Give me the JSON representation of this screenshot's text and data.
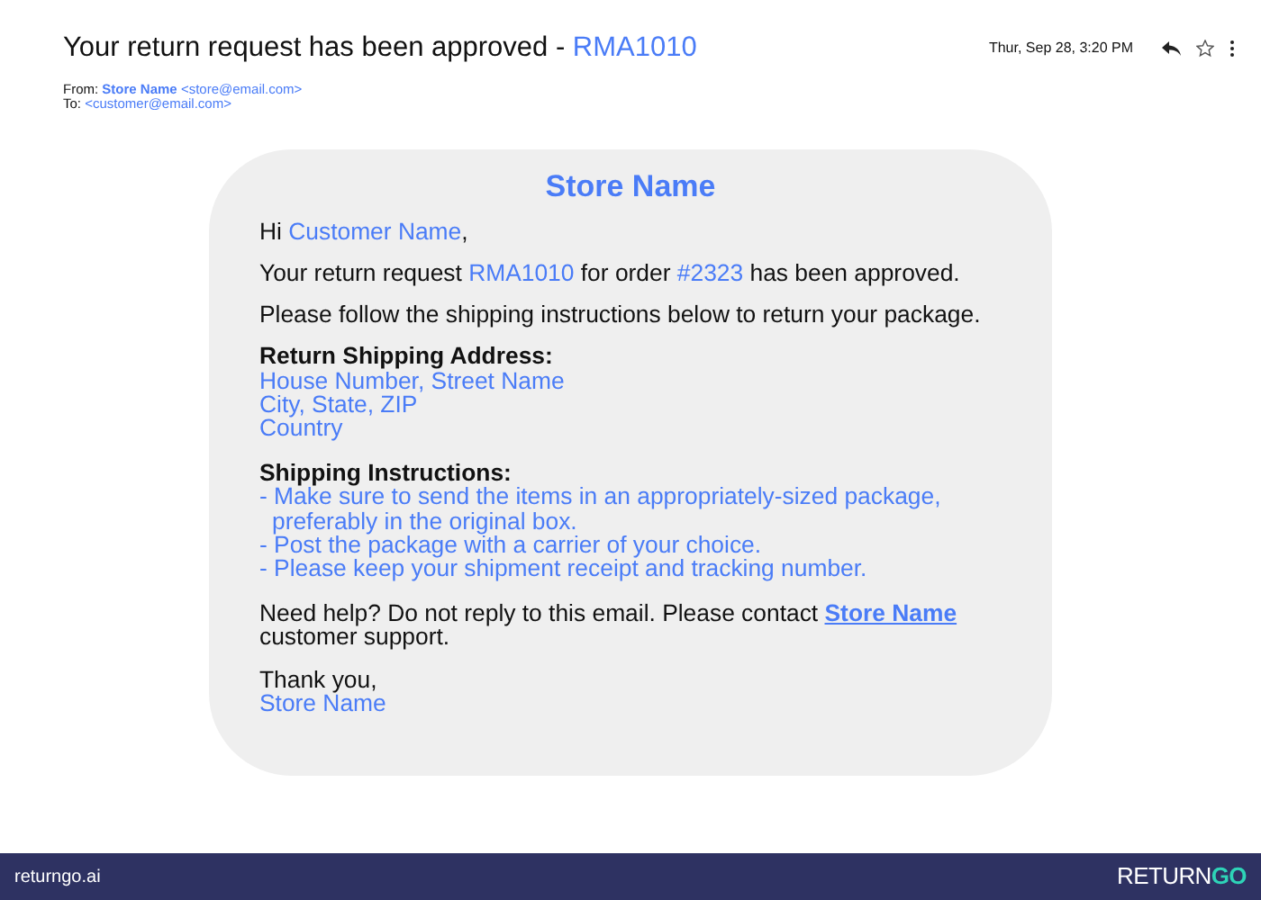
{
  "email": {
    "subject": [
      {
        "text": "Your return request has been approved - "
      },
      {
        "text": "RMA1010",
        "kind": "link"
      }
    ],
    "date": "Thur, Sep 28, 3:20 PM",
    "from": {
      "label": "From:",
      "name": "Store Name",
      "address": "<store@email.com>"
    },
    "to": {
      "label": "To:",
      "address": "<customer@email.com>"
    }
  },
  "card": {
    "title": "Store Name",
    "blocks": [
      {
        "kind": "para",
        "segments": [
          {
            "text": "Hi "
          },
          {
            "text": "Customer Name",
            "kind": "link"
          },
          {
            "text": ","
          }
        ]
      },
      {
        "kind": "para",
        "segments": [
          {
            "text": "Your return request "
          },
          {
            "text": "RMA1010",
            "kind": "link"
          },
          {
            "text": " for order "
          },
          {
            "text": "#2323",
            "kind": "link"
          },
          {
            "text": " has been approved."
          }
        ]
      },
      {
        "kind": "para",
        "segments": [
          {
            "text": "Please follow the shipping instructions below to return your package."
          }
        ]
      },
      {
        "kind": "section",
        "heading": "Return Shipping Address:",
        "lines": [
          "House Number, Street Name",
          "City, State, ZIP",
          "Country"
        ]
      },
      {
        "kind": "section",
        "heading": "Shipping Instructions:",
        "lines": [
          "- Make sure to send the items in an appropriately-sized package, preferably in the original box.",
          "- Post the package with a carrier of your choice.",
          "- Please keep your shipment receipt and tracking number."
        ]
      },
      {
        "kind": "para",
        "segments": [
          {
            "text": "Need help? Do not reply to this email. Please contact "
          },
          {
            "text": "Store Name",
            "kind": "strong-link"
          },
          {
            "text": " customer support."
          }
        ]
      },
      {
        "kind": "signoff",
        "heading": "Thank you,",
        "lines": [
          "Store Name"
        ]
      }
    ]
  },
  "footer": {
    "site": "returngo.ai",
    "logo": [
      "RETURN",
      "GO"
    ]
  }
}
